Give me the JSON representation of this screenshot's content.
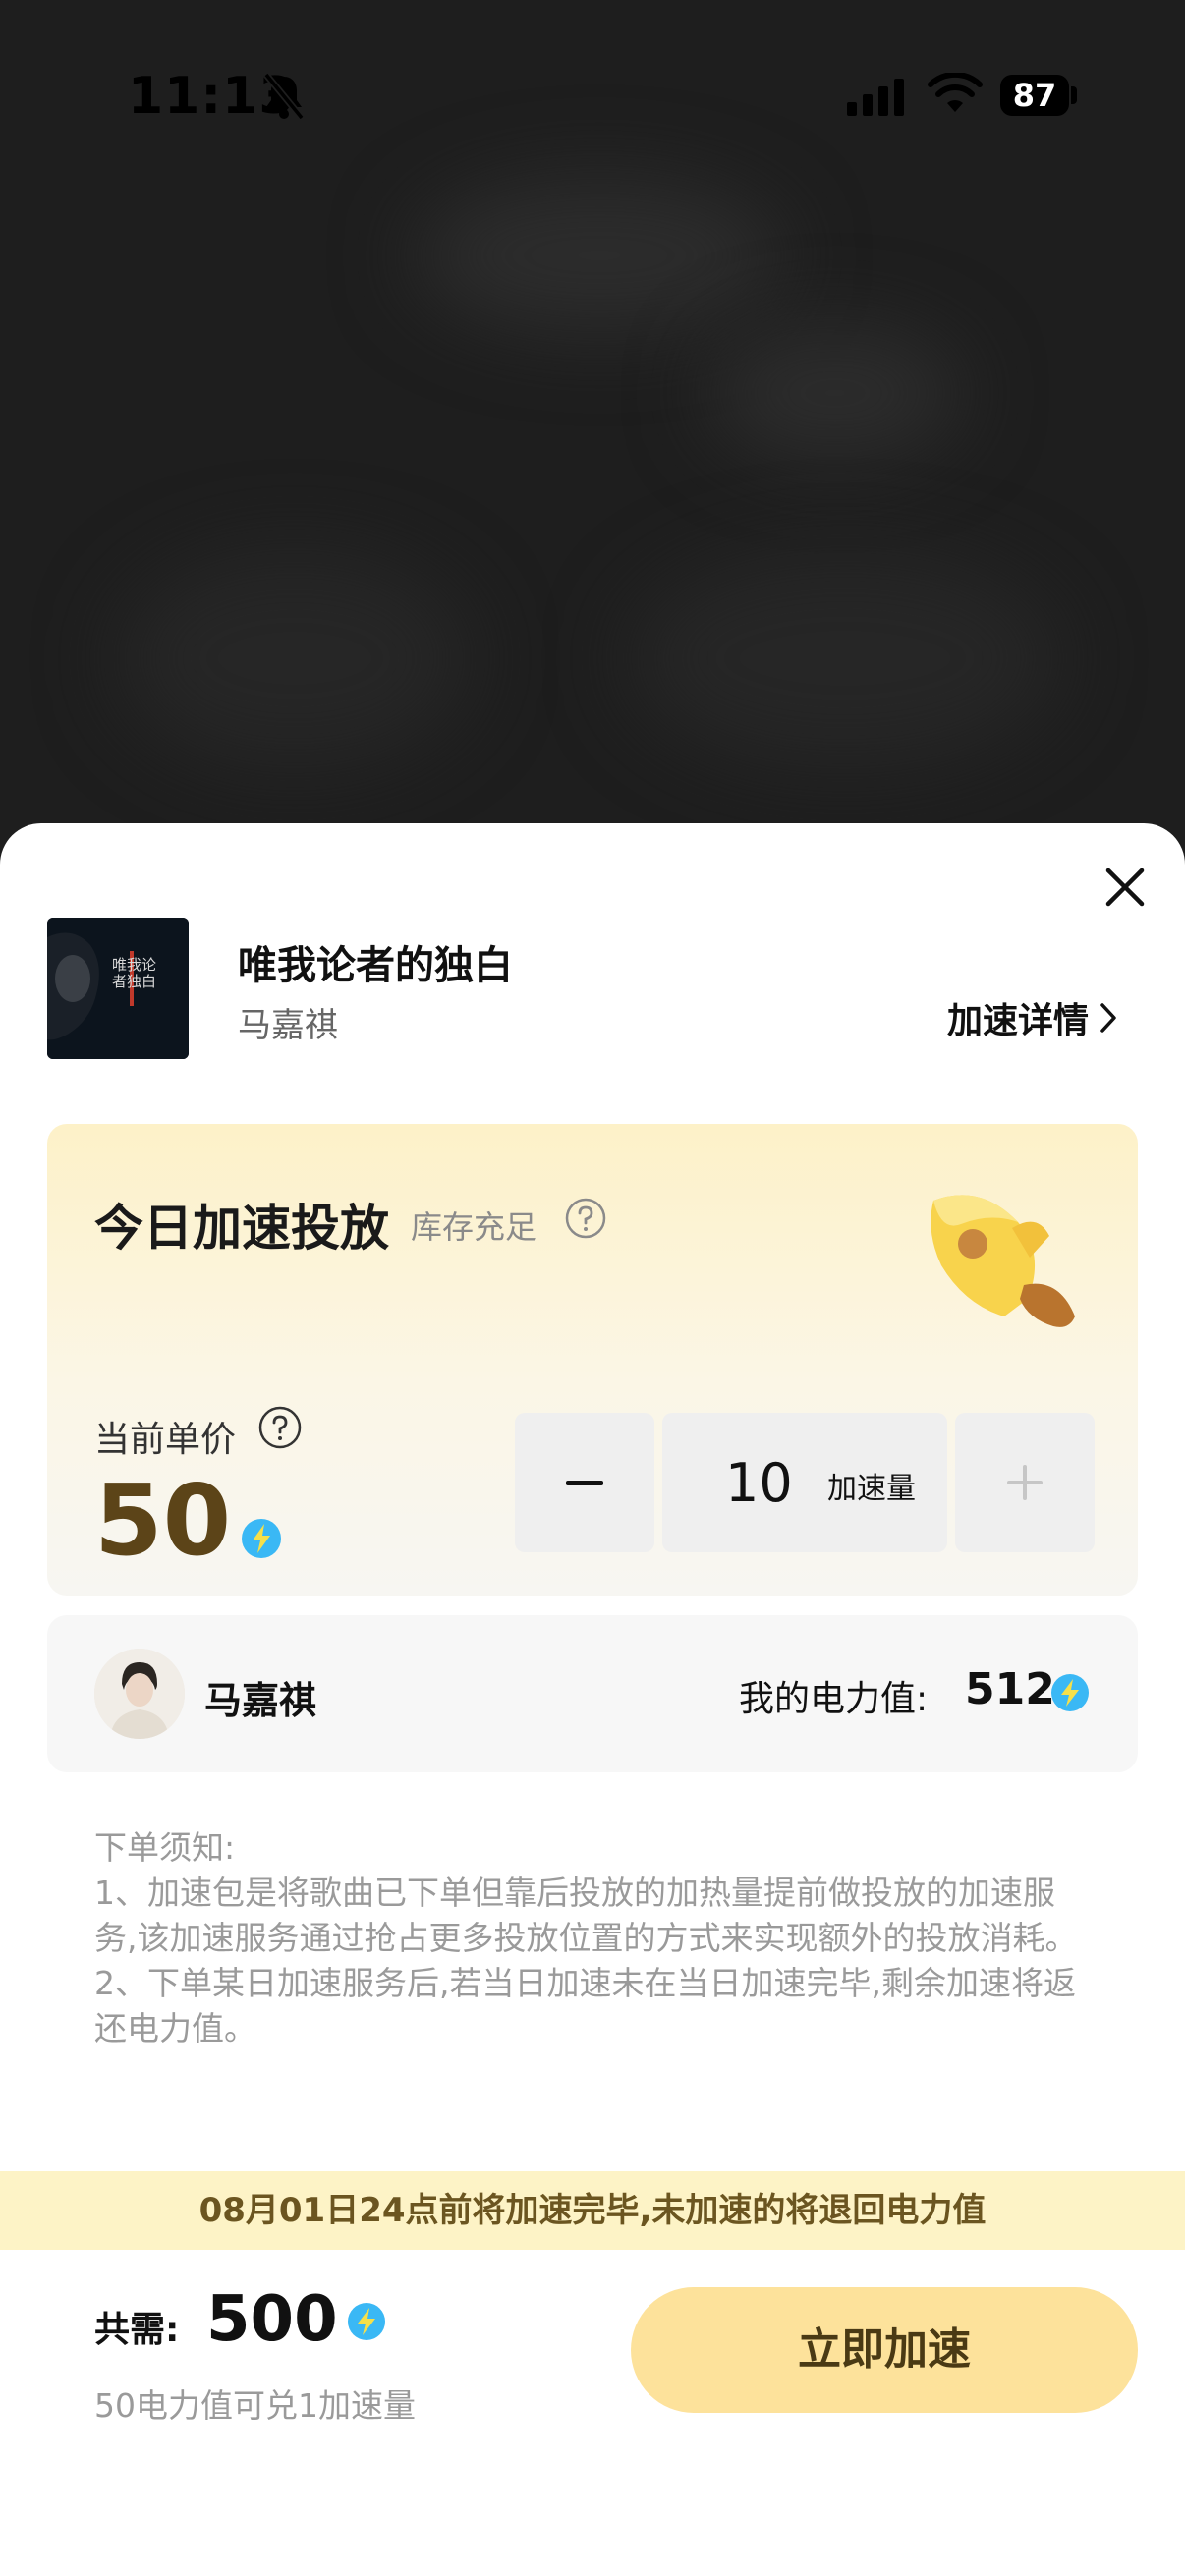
{
  "status_bar": {
    "time": "11:13",
    "battery": "87"
  },
  "song": {
    "title": "唯我论者的独白",
    "artist": "马嘉祺",
    "cover_text": "唯我论者独白"
  },
  "detail_link": "加速详情",
  "promo": {
    "title": "今日加速投放",
    "stock_status": "库存充足",
    "price_label": "当前单价",
    "price_value": "50",
    "quantity_value": "10",
    "quantity_unit": "加速量"
  },
  "account": {
    "name": "马嘉祺",
    "power_label": "我的电力值:",
    "power_value": "512"
  },
  "notes": {
    "heading": "下单须知:",
    "item1": "1、加速包是将歌曲已下单但靠后投放的加热量提前做投放的加速服务,该加速服务通过抢占更多投放位置的方式来实现额外的投放消耗。",
    "item2": "2、下单某日加速服务后,若当日加速未在当日加速完毕,剩余加速将返还电力值。"
  },
  "banner": "08月01日24点前将加速完毕,未加速的将退回电力值",
  "footer": {
    "total_label": "共需:",
    "total_value": "500",
    "exchange_note": "50电力值可兑1加速量",
    "cta_label": "立即加速"
  },
  "colors": {
    "cta_bg": "#fde29b",
    "banner_bg": "#fdf3c6",
    "price_color": "#5c4418",
    "bolt_blue": "#3ab8f5"
  },
  "icons": [
    "bell-muted-icon",
    "signal-icon",
    "wifi-icon",
    "close-icon",
    "chevron-right-icon",
    "help-icon",
    "rocket-icon",
    "bolt-icon"
  ]
}
